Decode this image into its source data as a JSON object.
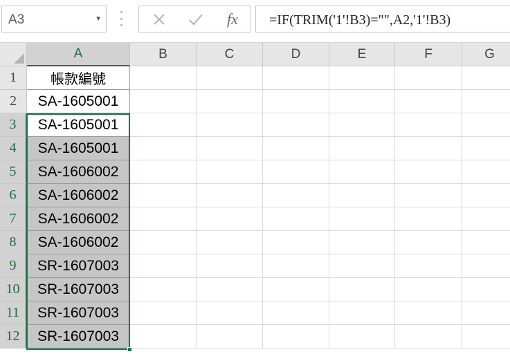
{
  "formula_bar": {
    "name_box": "A3",
    "cancel_icon": "x-icon",
    "enter_icon": "check-icon",
    "function_label": "fx",
    "formula": "=IF(TRIM('1'!B3)=\"\",A2,'1'!B3)"
  },
  "grid": {
    "columns": [
      "A",
      "B",
      "C",
      "D",
      "E",
      "F",
      "G"
    ],
    "rows": [
      "1",
      "2",
      "3",
      "4",
      "5",
      "6",
      "7",
      "8",
      "9",
      "10",
      "11",
      "12"
    ],
    "column_a_values": [
      "帳款編號",
      "SA-1605001",
      "SA-1605001",
      "SA-1605001",
      "SA-1606002",
      "SA-1606002",
      "SA-1606002",
      "SA-1606002",
      "SR-1607003",
      "SR-1607003",
      "SR-1607003",
      "SR-1607003"
    ],
    "selection": "A3:A12",
    "active_cell": "A3",
    "accent_color": "#217346",
    "selection_fill": "#c6c6c6"
  }
}
